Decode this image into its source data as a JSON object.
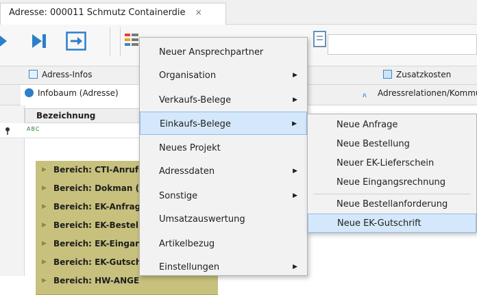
{
  "window": {
    "tab_title": "Adresse: 000011 Schmutz Containerdie",
    "tab_close": "×"
  },
  "colors": {
    "accent_blue": "#2c7fc9",
    "menu_highlight": "#d5e8fb",
    "row_olive": "#c7c17d"
  },
  "toolbar": {
    "icons": [
      "play-next-icon",
      "skip-end-icon",
      "exit-icon",
      "list-icon",
      "folder-icon",
      "alarm-clock-icon",
      "calendar-icon",
      "print-icon",
      "document-icon"
    ]
  },
  "tabs_row1": {
    "adress_infos": "Adress-Infos",
    "zusatzkosten": "Zusatzkosten"
  },
  "tabs_row2": {
    "infobaum": "Infobaum (Adresse)",
    "adressrelationen": "Adressrelationen/Kommun"
  },
  "grid": {
    "header": "Bezeichnung",
    "filter_icon_text": "ABC",
    "rows": [
      "Bereich: CTI-Anrufe",
      "Bereich: Dokman (",
      "Bereich: EK-Anfrag",
      "Bereich: EK-Bestel",
      "Bereich: EK-Eingar",
      "Bereich: EK-Gutschr",
      "Bereich: HW-ANGE"
    ]
  },
  "context_menu": {
    "items": [
      {
        "label": "Neuer Ansprechpartner",
        "submenu": false
      },
      {
        "label": "Organisation",
        "submenu": true
      },
      {
        "label": "Verkaufs-Belege",
        "submenu": true
      },
      {
        "label": "Einkaufs-Belege",
        "submenu": true
      },
      {
        "label": "Neues Projekt",
        "submenu": false
      },
      {
        "label": "Adressdaten",
        "submenu": true
      },
      {
        "label": "Sonstige",
        "submenu": true
      },
      {
        "label": "Umsatzauswertung",
        "submenu": false
      },
      {
        "label": "Artikelbezug",
        "submenu": false
      },
      {
        "label": "Einstellungen",
        "submenu": true
      }
    ],
    "active": "Einkaufs-Belege",
    "arrow": "▶"
  },
  "submenu": {
    "items": [
      "Neue Anfrage",
      "Neue Bestellung",
      "Neuer EK-Lieferschein",
      "Neue Eingangsrechnung",
      "Neue Bestellanforderung",
      "Neue EK-Gutschrift"
    ],
    "active": "Neue EK-Gutschrift"
  }
}
